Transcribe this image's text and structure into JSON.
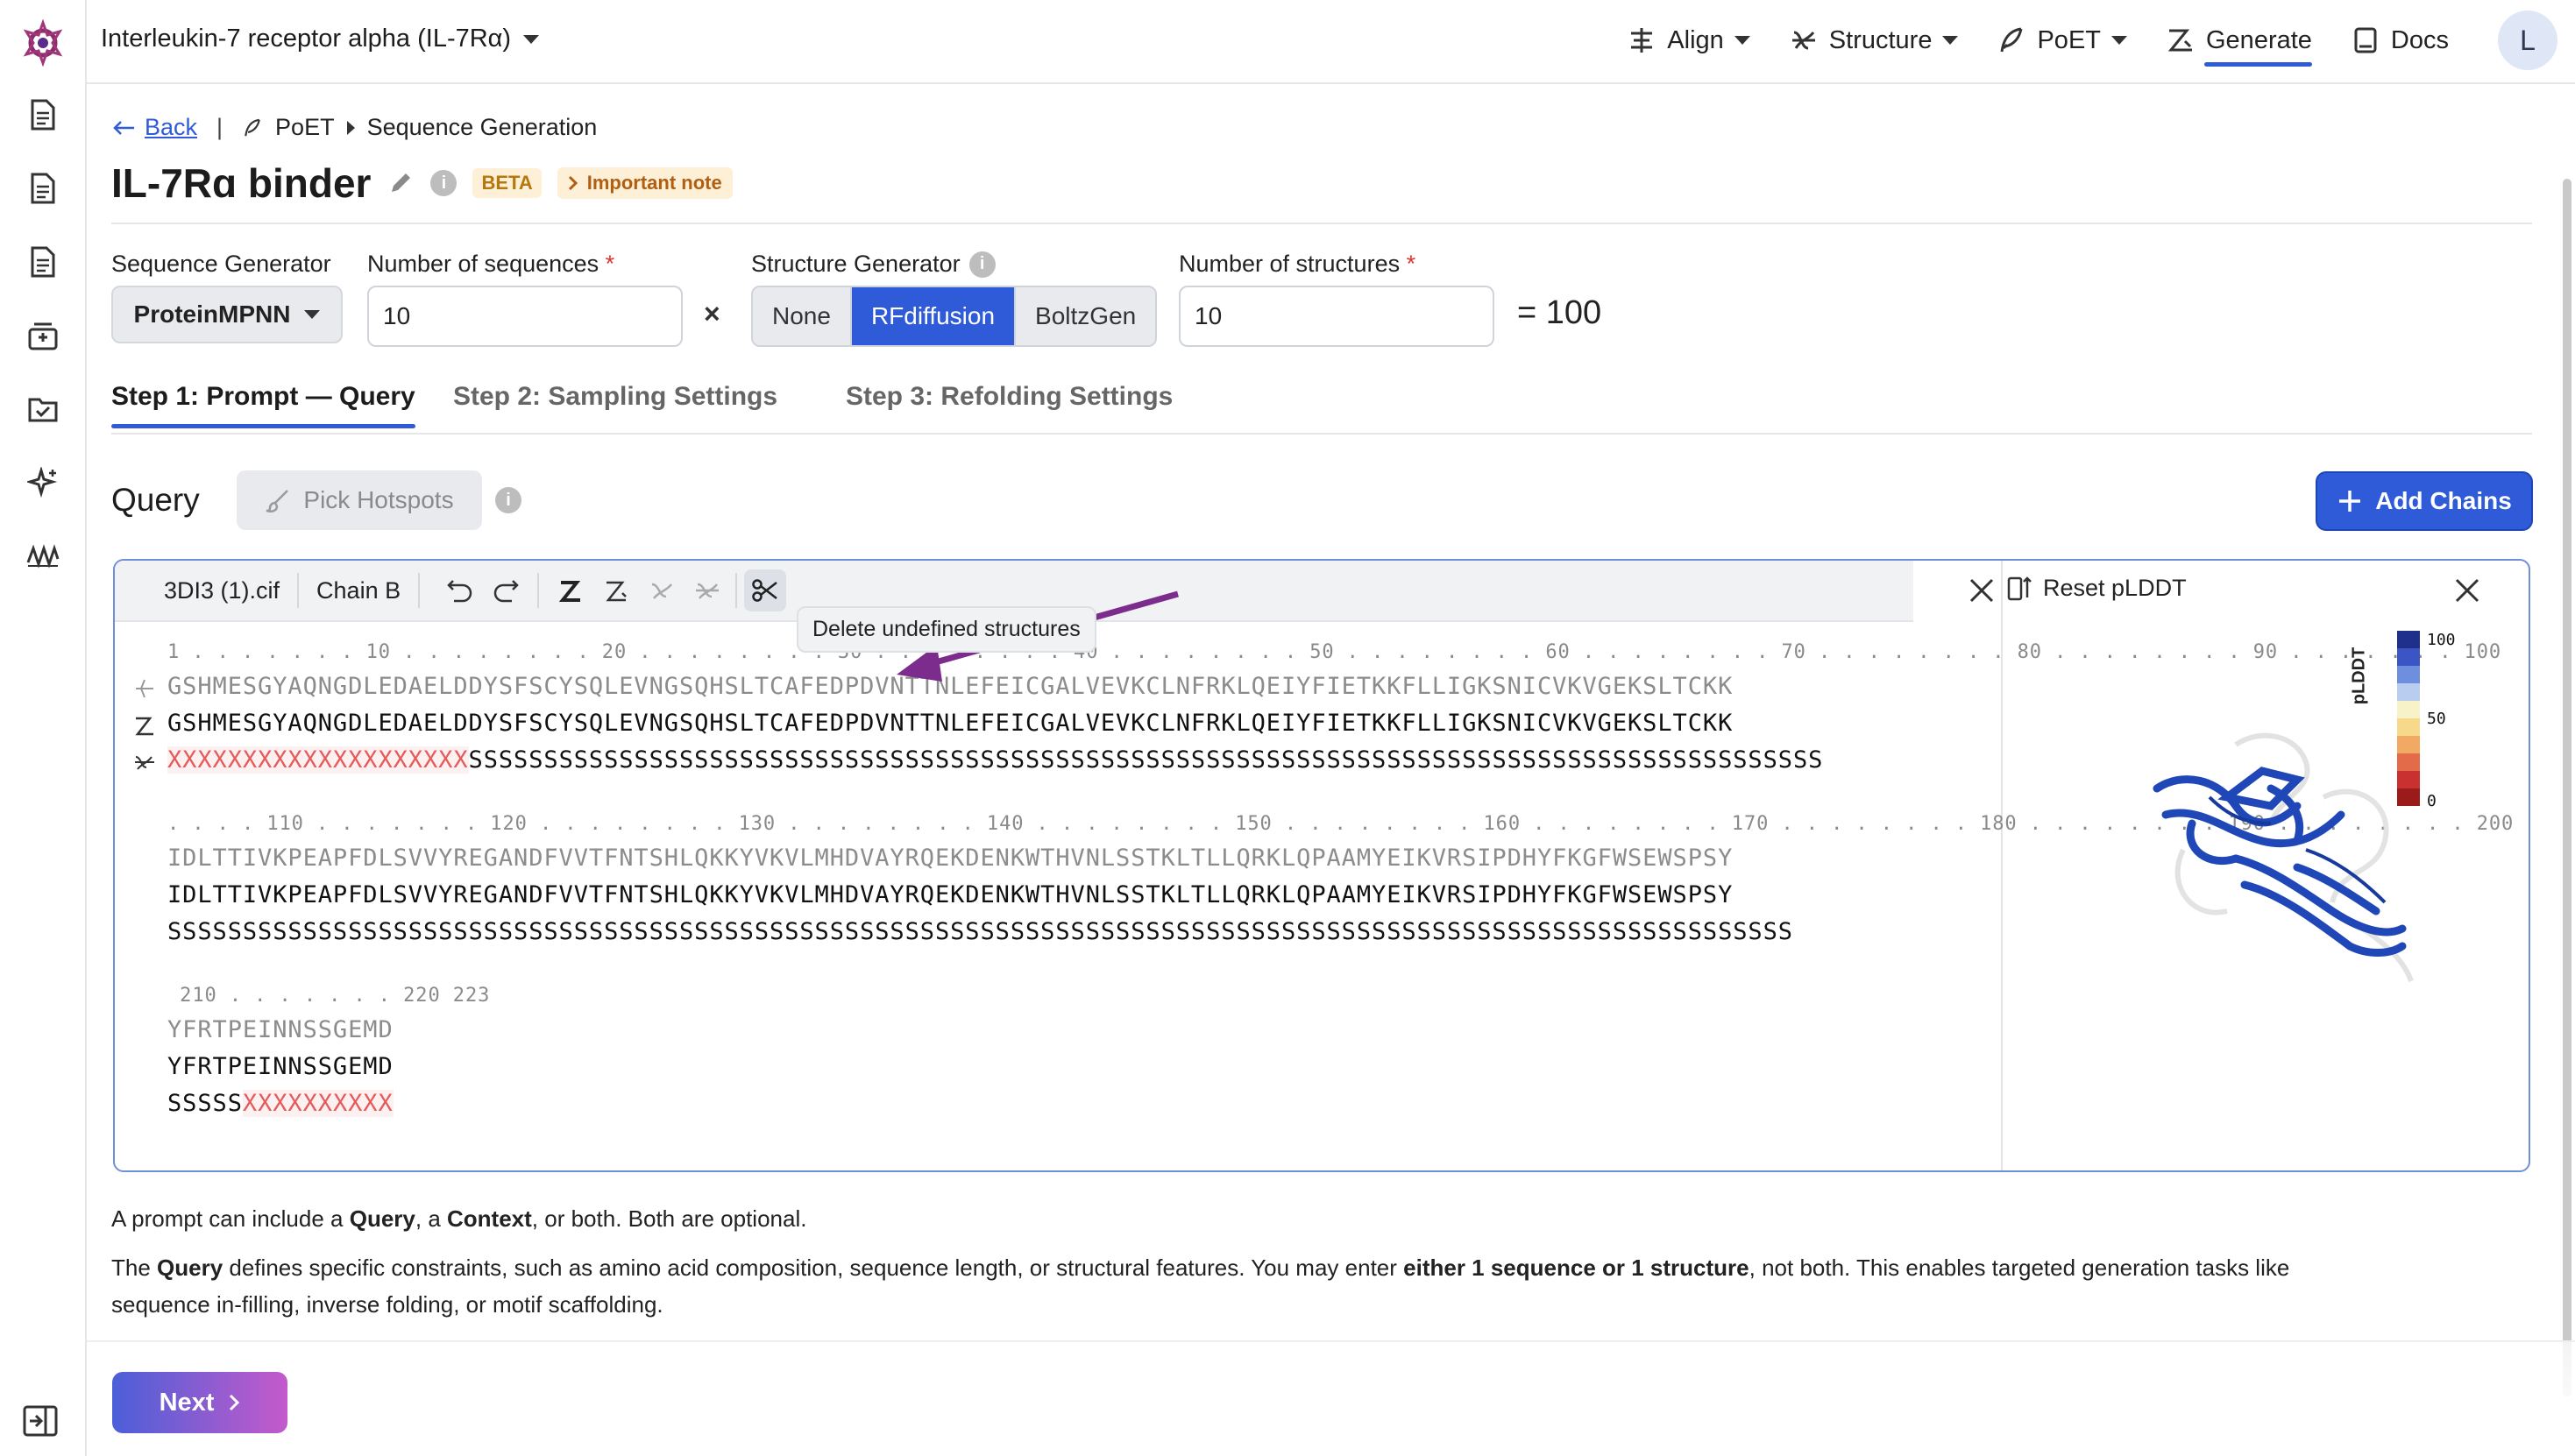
{
  "header": {
    "project": "Interleukin-7 receptor alpha (IL-7Rα)",
    "nav": [
      {
        "label": "Align",
        "icon": "align-icon",
        "dropdown": true
      },
      {
        "label": "Structure",
        "icon": "structure-icon",
        "dropdown": true
      },
      {
        "label": "PoET",
        "icon": "poet-icon",
        "dropdown": true
      },
      {
        "label": "Generate",
        "icon": "generate-icon",
        "active": true
      },
      {
        "label": "Docs",
        "icon": "docs-icon"
      }
    ],
    "avatar": "L"
  },
  "breadcrumb": {
    "back": "Back",
    "separator": "|",
    "section": "PoET",
    "page": "Sequence Generation"
  },
  "title": "IL-7Rɑ binder",
  "badges": {
    "beta": "BETA",
    "note": "Important note"
  },
  "form": {
    "sequence_generator_label": "Sequence Generator",
    "sequence_generator_value": "ProteinMPNN",
    "num_sequences_label": "Number of sequences",
    "num_sequences_value": "10",
    "times": "×",
    "structure_generator_label": "Structure Generator",
    "structure_options": [
      "None",
      "RFdiffusion",
      "BoltzGen"
    ],
    "structure_selected": "RFdiffusion",
    "num_structures_label": "Number of structures",
    "num_structures_value": "10",
    "total": "= 100",
    "required_mark": "*"
  },
  "tabs": [
    "Step 1: Prompt — Query",
    "Step 2: Sampling Settings",
    "Step 3: Refolding Settings"
  ],
  "query": {
    "title": "Query",
    "pick_hotspots": "Pick Hotspots",
    "add_chains": "Add Chains",
    "file": "3DI3 (1).cif",
    "chain": "Chain B",
    "tooltip": "Delete undefined structures",
    "reset_plddt": "Reset pLDDT",
    "legend_title": "pLDDT",
    "legend_ticks": [
      "100",
      "50",
      "0"
    ],
    "blocks": [
      {
        "ruler": "1 . . . . . . . 10 . . . . . . . . 20 . . . . . . . . 30 . . . . . . . . 40 . . . . . . . . 50 . . . . . . . . 60 . . . . . . . . 70 . . . . . . . . 80 . . . . . . . . 90 . . . . . . . 100",
        "faint": "GSHMESGYAQNGDLEDAELDDYSFSCYSQLEVNGSQHSLTCAFEDPDVNTTNLEFEICGALVEVKCLNFRKLQEIYFIETKKFLLIGKSNICVKVGEKSLTCKK",
        "seq": "GSHMESGYAQNGDLEDAELDDYSFSCYSQLEVNGSQHSLTCAFEDPDVNTTNLEFEICGALVEVKCLNFRKLQEIYFIETKKFLLIGKSNICVKVGEKSLTCKK",
        "struct_x": "XXXXXXXXXXXXXXXXXXXX",
        "struct_s": "SSSSSSSSSSSSSSSSSSSSSSSSSSSSSSSSSSSSSSSSSSSSSSSSSSSSSSSSSSSSSSSSSSSSSSSSSSSSSSSSSSSSSSSSSS"
      },
      {
        "ruler": ". . . . 110 . . . . . . . 120 . . . . . . . . 130 . . . . . . . . 140 . . . . . . . . 150 . . . . . . . . 160 . . . . . . . . 170 . . . . . . . . 180 . . . . . . . . 190 . . . . . . . . 200 . . . . . . .",
        "faint": "IDLTTIVKPEAPFDLSVVYREGANDFVVTFNTSHLQKKYVKVLMHDVAYRQEKDENKWTHVNLSSTKLTLLQRKLQPAAMYEIKVRSIPDHYFKGFWSEWSPSY",
        "seq": "IDLTTIVKPEAPFDLSVVYREGANDFVVTFNTSHLQKKYVKVLMHDVAYRQEKDENKWTHVNLSSTKLTLLQRKLQPAAMYEIKVRSIPDHYFKGFWSEWSPSY",
        "struct_x": "",
        "struct_s": "SSSSSSSSSSSSSSSSSSSSSSSSSSSSSSSSSSSSSSSSSSSSSSSSSSSSSSSSSSSSSSSSSSSSSSSSSSSSSSSSSSSSSSSSSSSSSSSSSSSSSSSSSSSS"
      },
      {
        "ruler": " 210 . . . . . . . 220 223",
        "faint": "YFRTPEINNSSGEMD",
        "seq": "YFRTPEINNSSGEMD",
        "struct_x": "",
        "struct_s": "SSSSS",
        "struct_x_after": "XXXXXXXXXX"
      }
    ]
  },
  "description": {
    "p1": [
      "A prompt can include a ",
      "Query",
      ", a ",
      "Context",
      ", or both. Both are optional."
    ],
    "p2a": [
      "The ",
      "Query",
      " defines specific constraints, such as amino acid composition, sequence length, or structural features. You may enter ",
      "either 1 sequence or 1 structure",
      ", not both. This enables targeted generation tasks like"
    ],
    "p2b": "sequence in-filling, inverse folding, or motif scaffolding."
  },
  "footer": {
    "next": "Next"
  },
  "colors": {
    "accent": "#2f5bd8",
    "arrow": "#7b2c8c",
    "beta_bg": "#fdf0d6",
    "protein": "#1f47b8"
  }
}
